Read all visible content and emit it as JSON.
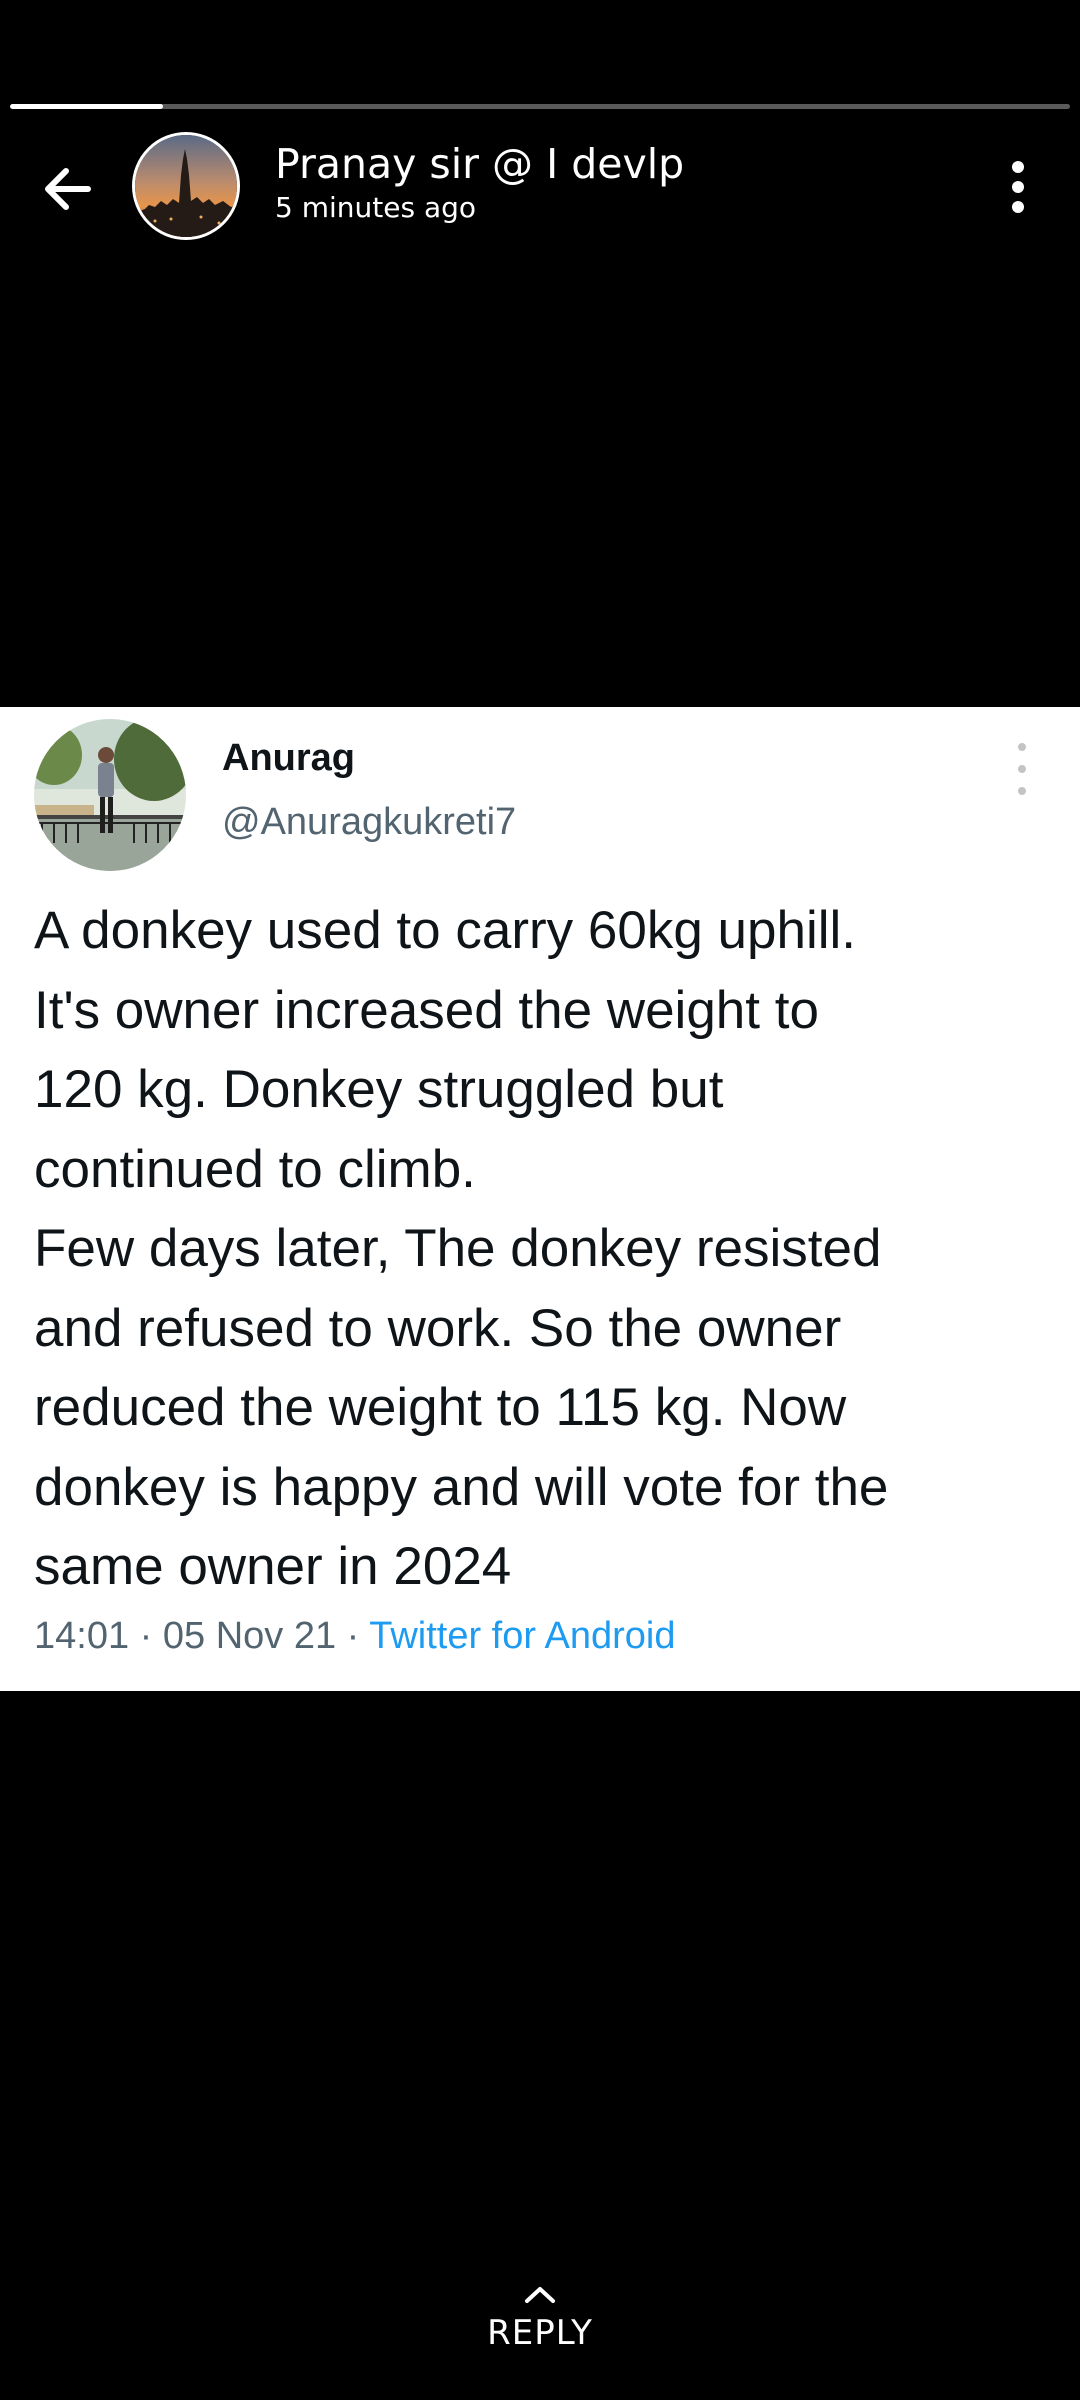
{
  "story": {
    "progress": 0.144,
    "poster_name": "Pranay sir @ I devlp",
    "time_ago": "5 minutes ago",
    "back_icon": "arrow-left-icon",
    "menu_icon": "more-vertical-icon"
  },
  "tweet": {
    "name": "Anurag",
    "handle": "@Anuragkukreti7",
    "lines": [
      "A donkey used to carry 60kg uphill.",
      "It's owner increased the weight to",
      "120 kg. Donkey struggled but",
      "continued to climb.",
      "Few days later, The donkey resisted",
      "and refused to work. So the owner",
      "reduced the weight to 115 kg. Now",
      "donkey is happy and will vote for the",
      "same owner in 2024"
    ],
    "time": "14:01",
    "date": "05 Nov 21",
    "separator": "·",
    "source": "Twitter for Android"
  },
  "reply": {
    "label": "REPLY",
    "icon": "chevron-up-icon"
  },
  "colors": {
    "background": "#000000",
    "text": "#ffffff",
    "tweet_text": "#0f1419",
    "tweet_secondary": "#536471",
    "tweet_link": "#1d9bf0"
  }
}
